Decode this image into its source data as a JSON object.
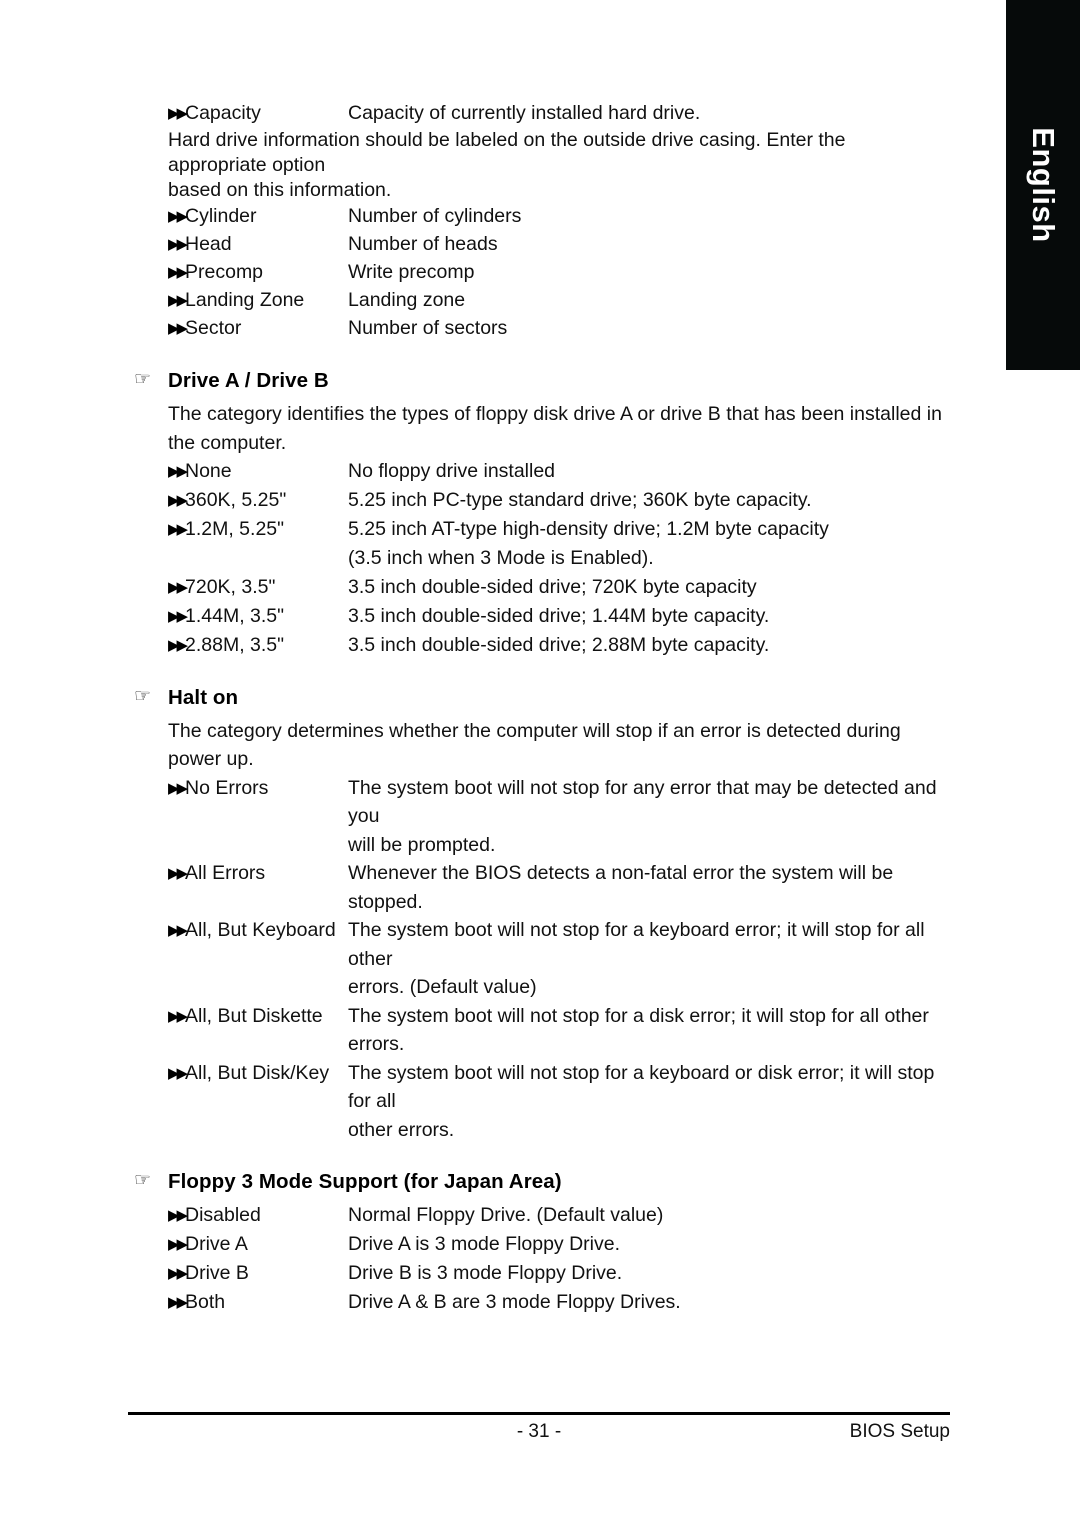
{
  "language_tab": {
    "label": "English"
  },
  "top_section": {
    "rows": [
      {
        "term": "Capacity",
        "desc": "Capacity of currently installed hard drive."
      }
    ],
    "note": "Hard drive information should be labeled on the outside drive casing. Enter the appropriate option\nbased on this information.",
    "rows2": [
      {
        "term": "Cylinder",
        "desc": "Number of cylinders"
      },
      {
        "term": "Head",
        "desc": "Number of heads"
      },
      {
        "term": "Precomp",
        "desc": "Write precomp"
      },
      {
        "term": "Landing Zone",
        "desc": "Landing zone"
      },
      {
        "term": "Sector",
        "desc": "Number of sectors"
      }
    ]
  },
  "sections": [
    {
      "title": "Drive A / Drive B",
      "intro": "The category identifies the types of floppy disk drive A or drive B that has been installed in the computer.",
      "rows": [
        {
          "term": "None",
          "desc": "No floppy drive installed",
          "cont": null
        },
        {
          "term": "360K, 5.25\"",
          "desc": "5.25 inch PC-type standard drive; 360K byte capacity.",
          "cont": null
        },
        {
          "term": "1.2M, 5.25\"",
          "desc": "5.25 inch AT-type high-density drive; 1.2M byte capacity",
          "cont": "(3.5 inch when 3 Mode is Enabled)."
        },
        {
          "term": "720K, 3.5\"",
          "desc": "3.5 inch double-sided drive; 720K byte capacity",
          "cont": null
        },
        {
          "term": "1.44M, 3.5\"",
          "desc": "3.5 inch double-sided drive; 1.44M byte capacity.",
          "cont": null
        },
        {
          "term": "2.88M, 3.5\"",
          "desc": "3.5 inch double-sided drive; 2.88M byte capacity.",
          "cont": null
        }
      ]
    },
    {
      "title": "Halt on",
      "intro": "The category determines whether the computer will stop if an error is detected during power up.",
      "rows": [
        {
          "term": "No Errors",
          "desc": "The system boot will not stop for any error that may be detected and  you",
          "cont": "will be prompted."
        },
        {
          "term": "All Errors",
          "desc": "Whenever the BIOS detects a non-fatal error the system will be stopped.",
          "cont": null
        },
        {
          "term": "All, But Keyboard",
          "desc": "The system boot will not stop for a keyboard error; it will stop for all other",
          "cont": "errors. (Default value)"
        },
        {
          "term": "All, But Diskette",
          "desc": "The system boot will not stop for a disk error; it will stop for all other errors.",
          "cont": null
        },
        {
          "term": "All, But Disk/Key",
          "desc": "The system boot will not stop for a keyboard or disk error; it will stop for all",
          "cont": "other errors."
        }
      ]
    },
    {
      "title": "Floppy 3 Mode Support (for Japan Area)",
      "intro": null,
      "rows": [
        {
          "term": "Disabled",
          "desc": "Normal Floppy Drive. (Default value)",
          "cont": null
        },
        {
          "term": "Drive A",
          "desc": "Drive A is 3 mode Floppy Drive.",
          "cont": null
        },
        {
          "term": "Drive B",
          "desc": "Drive B is 3 mode Floppy Drive.",
          "cont": null
        },
        {
          "term": "Both",
          "desc": "Drive A & B are 3 mode Floppy Drives.",
          "cont": null
        }
      ]
    }
  ],
  "icons": {
    "hand": "☞",
    "bullet": "▶▶"
  },
  "footer": {
    "page_number": "- 31 -",
    "right_label": "BIOS Setup"
  }
}
